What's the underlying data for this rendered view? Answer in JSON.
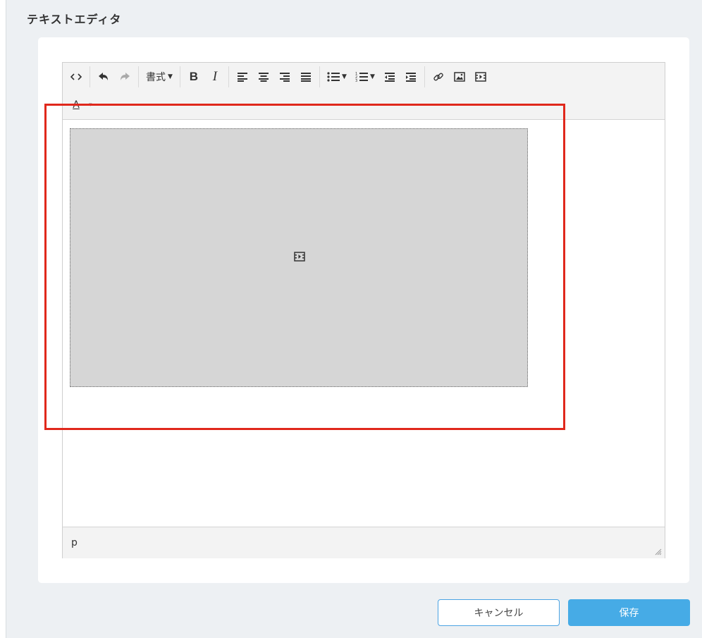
{
  "page": {
    "title": "テキストエディタ"
  },
  "toolbar": {
    "format_label": "書式",
    "icons": [
      "code-icon",
      "undo-icon",
      "redo-icon",
      "bold-icon",
      "italic-icon",
      "align-left-icon",
      "align-center-icon",
      "align-right-icon",
      "align-justify-icon",
      "bullet-list-icon",
      "numbered-list-icon",
      "outdent-icon",
      "indent-icon",
      "link-icon",
      "image-icon",
      "media-icon",
      "text-color-icon"
    ],
    "bold_glyph": "B",
    "italic_glyph": "I",
    "text_color_glyph": "A"
  },
  "statusbar": {
    "path": "p"
  },
  "buttons": {
    "cancel": "キャンセル",
    "save": "保存"
  },
  "colors": {
    "highlight": "#e0281c",
    "save_button": "#46abe6",
    "cancel_border": "#4ba3e3"
  }
}
